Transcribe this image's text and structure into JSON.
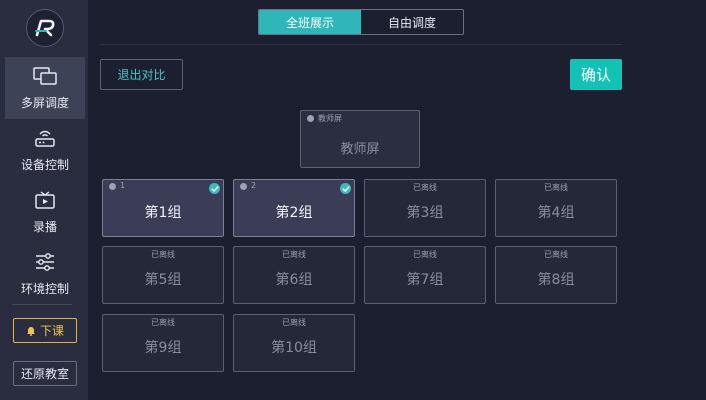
{
  "sidebar": {
    "logo": "R",
    "items": [
      {
        "label": "多屏调度",
        "icon": "multi-screen-icon",
        "active": true
      },
      {
        "label": "设备控制",
        "icon": "router-icon",
        "active": false
      },
      {
        "label": "录播",
        "icon": "tv-icon",
        "active": false
      },
      {
        "label": "环境控制",
        "icon": "sliders-icon",
        "active": false
      }
    ],
    "end_class_label": "下课",
    "restore_label": "还原教室"
  },
  "tabs": [
    {
      "label": "全班展示",
      "active": true
    },
    {
      "label": "自由调度",
      "active": false
    }
  ],
  "actions": {
    "exit_compare_label": "退出对比",
    "confirm_label": "确认"
  },
  "teacher": {
    "tag": "教师屏",
    "name": "教师屏"
  },
  "groups": [
    {
      "name": "第1组",
      "num": "1",
      "online": true,
      "checked": true
    },
    {
      "name": "第2组",
      "num": "2",
      "online": true,
      "checked": true
    },
    {
      "name": "第3组",
      "status": "已离线",
      "online": false
    },
    {
      "name": "第4组",
      "status": "已离线",
      "online": false
    },
    {
      "name": "第5组",
      "status": "已离线",
      "online": false
    },
    {
      "name": "第6组",
      "status": "已离线",
      "online": false
    },
    {
      "name": "第7组",
      "status": "已离线",
      "online": false
    },
    {
      "name": "第8组",
      "status": "已离线",
      "online": false
    },
    {
      "name": "第9组",
      "status": "已离线",
      "online": false
    },
    {
      "name": "第10组",
      "status": "已离线",
      "online": false
    }
  ],
  "colors": {
    "accent": "#2fb6b8",
    "confirm": "#13c1b5",
    "end_class": "#e8b23c",
    "background": "#1c1f30",
    "sidebar": "#2a2d3f"
  }
}
